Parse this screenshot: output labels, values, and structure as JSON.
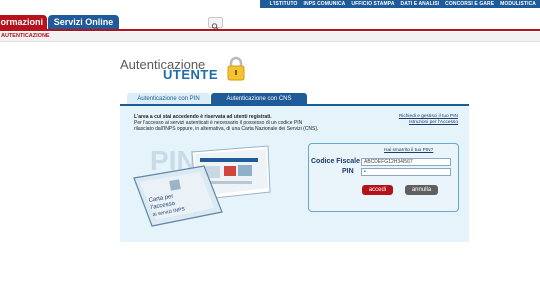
{
  "top_links": [
    "L'ISTITUTO",
    "INPS COMUNICA",
    "UFFICIO STAMPA",
    "DATI E ANALISI",
    "CONCORSI E GARE",
    "MODULISTICA"
  ],
  "nav": {
    "tab_info": "ormazioni",
    "tab_servizi": "Servizi Online"
  },
  "breadcrumb": "AUTENTICAZIONE",
  "title": {
    "line1": "Autenticazione",
    "line2": "UTENTE"
  },
  "tabs": {
    "pin": "Autenticazione con PIN",
    "cns": "Autenticazione con CNS"
  },
  "intro": {
    "line1": "L'area a cui stai accedendo è riservata ad utenti registrati.",
    "line2": "Per l'accesso ai servizi autenticati è necessario il possesso di un codice PIN",
    "line3": "rilasciato dall'INPS oppure, in alternativa, di una Carta Nazionale dei Servizi (CNS)."
  },
  "right_links": {
    "req": "Richiedi e gestisci il tuo PIN",
    "instr": "Istruzioni per l'Accesso"
  },
  "pin_art": {
    "big": "PIN",
    "card_text1": "Carta per",
    "card_text2": "l'accesso",
    "card_text3": "ai servizi INPS"
  },
  "login": {
    "forgot": "Hai smarrito il tuo PIN?",
    "cf_label": "Codice Fiscale",
    "cf_value": "ABCDEFG12H34I567",
    "pin_label": "PIN",
    "pin_value": "•",
    "accedi": "accedi",
    "annulla": "annulla"
  }
}
